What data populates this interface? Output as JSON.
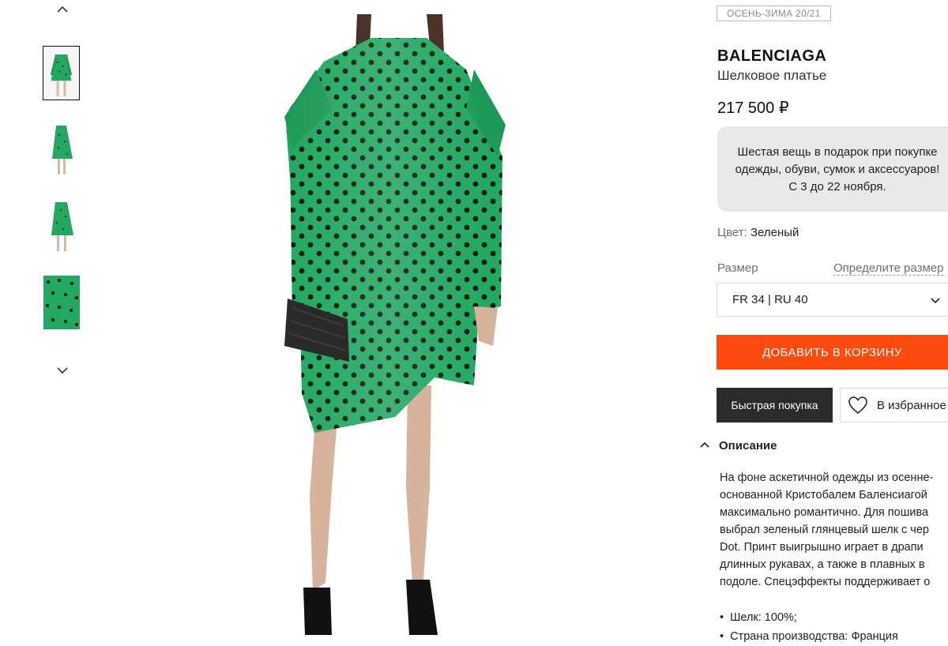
{
  "gallery": {
    "thumbnails": [
      {
        "alt": "thumbnail-front",
        "active": true
      },
      {
        "alt": "thumbnail-side"
      },
      {
        "alt": "thumbnail-back"
      },
      {
        "alt": "thumbnail-detail"
      }
    ]
  },
  "product": {
    "season": "ОСЕНЬ-ЗИМА 20/21",
    "brand": "BALENCIAGA",
    "name": "Шелковое платье",
    "price": "217 500 ₽",
    "promo": "Шестая вещь в подарок при покупке одежды, обуви, сумок и аксессуаров! С 3 до 22 ноября.",
    "color_label": "Цвет:",
    "color_value": "Зеленый",
    "size_label": "Размер",
    "size_link": "Определите размер",
    "size_value": "FR 34 | RU 40",
    "add_to_cart": "ДОБАВИТЬ В КОРЗИНУ",
    "quick_buy": "Быстрая покупка",
    "favorites": "В избранное"
  },
  "description": {
    "title": "Описание",
    "text": "На фоне аскетичной одежды из осенне-\nоснованной Кристобалем Баленсиагой\nмаксимально романтично. Для пошива\nвыбрал зеленый глянцевый шелк с чер\nDot. Принт выигрышно играет в драпи\nдлинных рукавах, а также в плавных в\nподоле. Спецэффекты поддерживает о",
    "facts": [
      "Шелк: 100%;",
      "Страна производства: Франция"
    ]
  },
  "colors": {
    "accent": "#fc4a0e",
    "dress": "#22a861",
    "dark_button": "#2b2b2b",
    "promo_bg": "#e9e9e9"
  }
}
